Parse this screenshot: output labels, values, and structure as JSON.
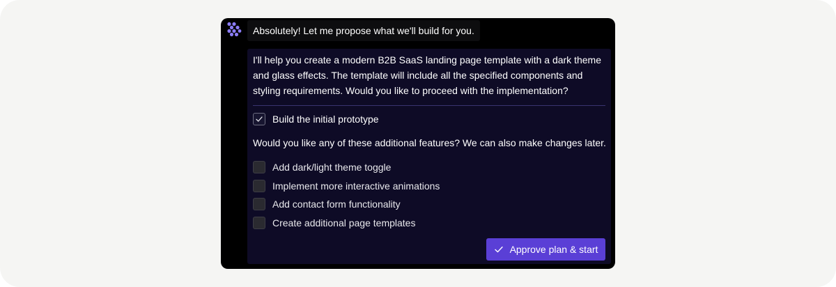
{
  "assistant": {
    "logo_icon": "sparkle-dots-logo-icon",
    "header_message": "Absolutely! Let me propose what we'll build for you."
  },
  "plan": {
    "intro": "I'll help you create a modern B2B SaaS landing page template with a dark theme and glass effects. The template will include all the specified components and styling requirements. Would you like to proceed with the implementation?",
    "base_item": {
      "label": "Build the initial prototype",
      "checked": true
    },
    "question": "Would you like any of these additional features? We can also make changes later.",
    "features": [
      {
        "label": "Add dark/light theme toggle",
        "checked": false
      },
      {
        "label": "Implement more interactive animations",
        "checked": false
      },
      {
        "label": "Add contact form functionality",
        "checked": false
      },
      {
        "label": "Create additional page templates",
        "checked": false
      }
    ],
    "approve_button": {
      "label": "Approve plan & start",
      "icon": "check-icon"
    }
  },
  "colors": {
    "accent": "#5a3fd6",
    "panel_background": "#0e0b26",
    "window_background": "#000000",
    "logo": "#8b7cf6"
  }
}
